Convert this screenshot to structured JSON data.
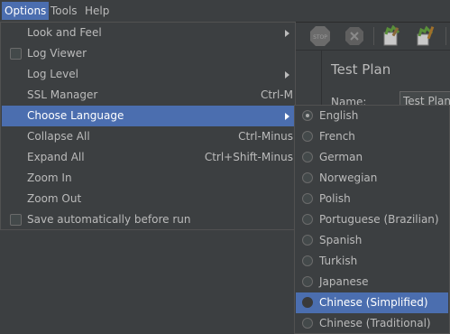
{
  "menubar": {
    "options": "Options",
    "tools": "Tools",
    "help": "Help"
  },
  "options_menu": {
    "items": [
      {
        "label": "Look and Feel",
        "accelerator": "",
        "submenu": true,
        "checkbox": false
      },
      {
        "label": "Log Viewer",
        "accelerator": "",
        "submenu": false,
        "checkbox": true
      },
      {
        "label": "Log Level",
        "accelerator": "",
        "submenu": true,
        "checkbox": false
      },
      {
        "label": "SSL Manager",
        "accelerator": "Ctrl-M",
        "submenu": false,
        "checkbox": false
      },
      {
        "label": "Choose Language",
        "accelerator": "",
        "submenu": true,
        "checkbox": false,
        "selected": true
      },
      {
        "label": "Collapse All",
        "accelerator": "Ctrl-Minus",
        "submenu": false,
        "checkbox": false
      },
      {
        "label": "Expand All",
        "accelerator": "Ctrl+Shift-Minus",
        "submenu": false,
        "checkbox": false
      },
      {
        "label": "Zoom In",
        "accelerator": "",
        "submenu": false,
        "checkbox": false
      },
      {
        "label": "Zoom Out",
        "accelerator": "",
        "submenu": false,
        "checkbox": false
      },
      {
        "label": "Save automatically before run",
        "accelerator": "",
        "submenu": false,
        "checkbox": true
      }
    ]
  },
  "language_menu": {
    "items": [
      {
        "label": "English",
        "checked": true
      },
      {
        "label": "French",
        "checked": false
      },
      {
        "label": "German",
        "checked": false
      },
      {
        "label": "Norwegian",
        "checked": false
      },
      {
        "label": "Polish",
        "checked": false
      },
      {
        "label": "Portuguese (Brazilian)",
        "checked": false
      },
      {
        "label": "Spanish",
        "checked": false
      },
      {
        "label": "Turkish",
        "checked": false
      },
      {
        "label": "Japanese",
        "checked": false
      },
      {
        "label": "Chinese (Simplified)",
        "checked": false,
        "hovered": true
      },
      {
        "label": "Chinese (Traditional)",
        "checked": false
      }
    ]
  },
  "toolbar": {
    "icons": [
      "stop-icon",
      "shutdown-icon",
      "clear-icon",
      "clear-all-icon"
    ],
    "stop_text": "STOP"
  },
  "test_plan": {
    "title": "Test Plan",
    "name_label": "Name:",
    "name_value": "Test Plan"
  },
  "colors": {
    "menu_bg": "#3c3f41",
    "selection": "#4b6eaf",
    "text": "#bbbbbb"
  }
}
